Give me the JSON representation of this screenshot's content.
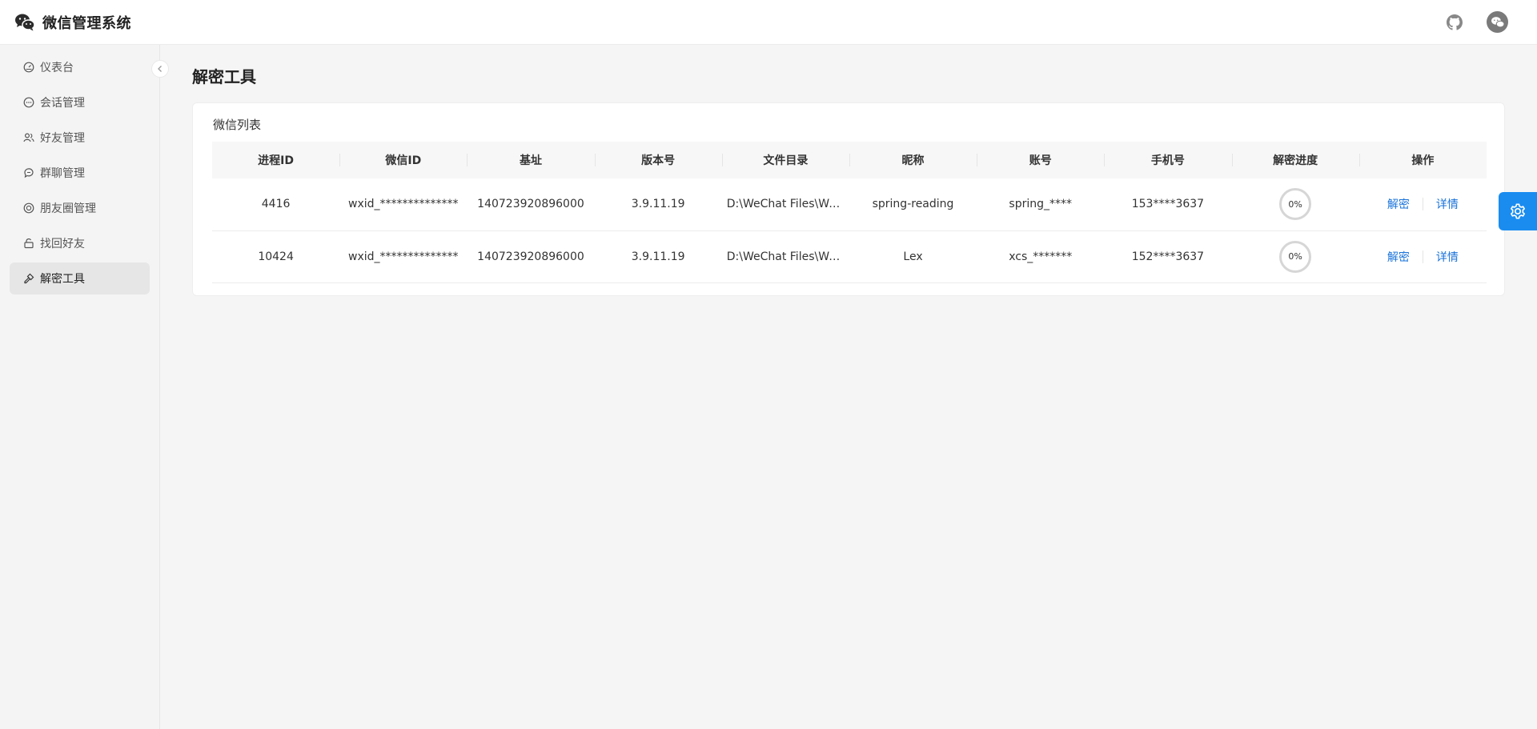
{
  "app": {
    "title": "微信管理系统"
  },
  "sidebar": {
    "items": [
      {
        "label": "仪表台",
        "icon": "dashboard-icon"
      },
      {
        "label": "会话管理",
        "icon": "chat-icon"
      },
      {
        "label": "好友管理",
        "icon": "users-icon"
      },
      {
        "label": "群聊管理",
        "icon": "group-chat-icon"
      },
      {
        "label": "朋友圈管理",
        "icon": "moments-icon"
      },
      {
        "label": "找回好友",
        "icon": "recover-icon"
      },
      {
        "label": "解密工具",
        "icon": "key-icon"
      }
    ],
    "active_index": 6
  },
  "page": {
    "title": "解密工具"
  },
  "card": {
    "title": "微信列表"
  },
  "table": {
    "headers": [
      "进程ID",
      "微信ID",
      "基址",
      "版本号",
      "文件目录",
      "昵称",
      "账号",
      "手机号",
      "解密进度",
      "操作"
    ],
    "rows": [
      {
        "pid": "4416",
        "wxid": "wxid_**************",
        "base": "140723920896000",
        "version": "3.9.11.19",
        "dir": "D:\\WeChat Files\\WeC...",
        "nickname": "spring-reading",
        "account": "spring_****",
        "phone": "153****3637",
        "progress": "0%",
        "action_decrypt": "解密",
        "action_detail": "详情"
      },
      {
        "pid": "10424",
        "wxid": "wxid_**************",
        "base": "140723920896000",
        "version": "3.9.11.19",
        "dir": "D:\\WeChat Files\\WeC...",
        "nickname": "Lex",
        "account": "xcs_*******",
        "phone": "152****3637",
        "progress": "0%",
        "action_decrypt": "解密",
        "action_detail": "详情"
      }
    ]
  },
  "colors": {
    "accent": "#1a8cf0",
    "link": "#1a73d9",
    "sidebar_active": "#e6e6e6"
  },
  "icons": {
    "logo": "wechat-icon",
    "github": "github-icon",
    "avatar": "wechat-avatar-icon",
    "settings": "gear-icon",
    "collapse": "chevron-left-icon"
  }
}
